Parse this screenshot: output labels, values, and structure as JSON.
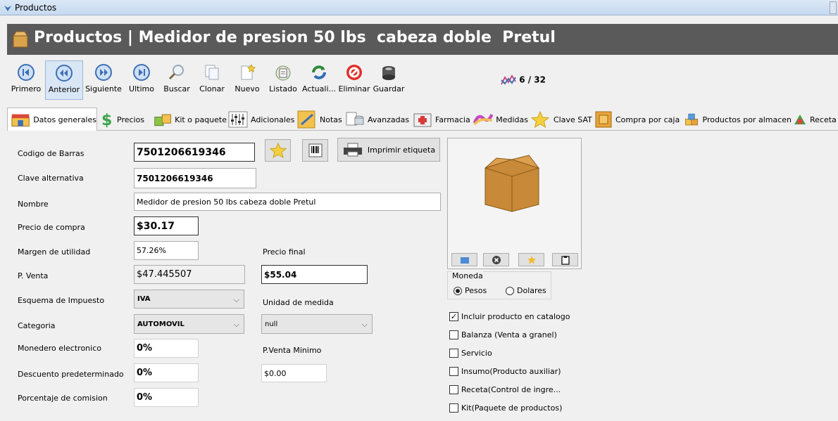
{
  "window": {
    "title": "Productos"
  },
  "header": {
    "title": "Productos | Medidor de presion 50 lbs  cabeza doble  Pretul"
  },
  "toolbar": {
    "buttons": [
      {
        "label": "Primero",
        "icon": "first-icon"
      },
      {
        "label": "Anterior",
        "icon": "previous-icon"
      },
      {
        "label": "Siguiente",
        "icon": "next-icon"
      },
      {
        "label": "Ultimo",
        "icon": "last-icon"
      },
      {
        "label": "Buscar",
        "icon": "search-icon"
      },
      {
        "label": "Clonar",
        "icon": "clone-icon"
      },
      {
        "label": "Nuevo",
        "icon": "new-icon"
      },
      {
        "label": "Listado",
        "icon": "list-icon"
      },
      {
        "label": "Actuali...",
        "icon": "refresh-icon"
      },
      {
        "label": "Eliminar",
        "icon": "delete-icon"
      },
      {
        "label": "Guardar",
        "icon": "save-icon"
      }
    ],
    "counter": "6 / 32"
  },
  "tabs": [
    {
      "label": "Datos generales"
    },
    {
      "label": "Precios"
    },
    {
      "label": "Kit o paquete"
    },
    {
      "label": "Adicionales"
    },
    {
      "label": "Notas"
    },
    {
      "label": "Avanzadas"
    },
    {
      "label": "Farmacia"
    },
    {
      "label": "Medidas"
    },
    {
      "label": "Clave SAT"
    },
    {
      "label": "Compra por caja"
    },
    {
      "label": "Productos por almacen"
    },
    {
      "label": "Receta"
    }
  ],
  "form": {
    "codigo_label": "Codigo de Barras",
    "codigo_value": "7501206619346",
    "clave_label": "Clave alternativa",
    "clave_value": "7501206619346",
    "nombre_label": "Nombre",
    "nombre_value": "Medidor de presion 50 lbs  cabeza doble  Pretul",
    "precio_compra_label": "Precio de compra",
    "precio_compra_value": "$30.17",
    "margen_label": "Margen de utilidad",
    "margen_value": "57.26%",
    "precio_final_label": "Precio final",
    "pventa_label": "P. Venta",
    "pventa_value": "$47.445507",
    "precio_final_value": "$55.04",
    "esquema_label": "Esquema de Impuesto",
    "esquema_value": "IVA",
    "unidad_label": "Unidad de medida",
    "categoria_label": "Categoria",
    "categoria_value": "AUTOMOVIL",
    "unidad_value": "null",
    "monedero_label": "Monedero electronico",
    "monedero_value": "0%",
    "pventa_min_label": "P.Venta Minimo",
    "descuento_label": "Descuento predeterminado",
    "descuento_value": "0%",
    "pventa_min_value": "$0.00",
    "comision_label": "Porcentaje de comision",
    "comision_value": "0%",
    "imprimir_label": "Imprimir etiqueta"
  },
  "moneda": {
    "label": "Moneda",
    "pesos": "Pesos",
    "dolares": "Dolares",
    "selected": "Pesos"
  },
  "checks": [
    {
      "label": "Incluir producto en catalogo",
      "checked": true
    },
    {
      "label": "Balanza (Venta a granel)",
      "checked": false
    },
    {
      "label": "Servicio",
      "checked": false
    },
    {
      "label": "Insumo(Producto auxiliar)",
      "checked": false
    },
    {
      "label": "Receta(Control de ingre...",
      "checked": false
    },
    {
      "label": "Kit(Paquete de productos)",
      "checked": false
    }
  ]
}
